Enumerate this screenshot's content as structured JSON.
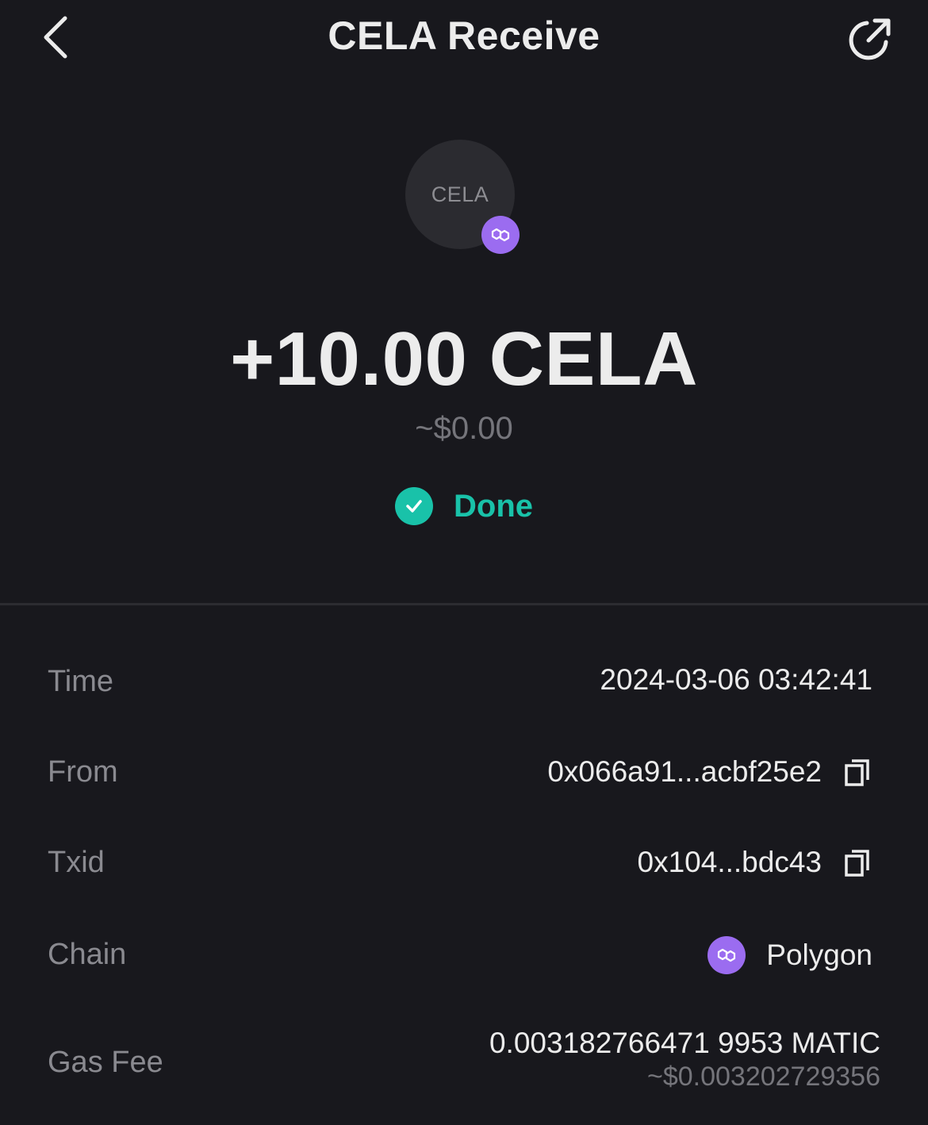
{
  "header": {
    "title": "CELA Receive",
    "back_icon": "chevron-left-icon",
    "share_icon": "external-link-icon"
  },
  "token": {
    "symbol": "CELA",
    "chain_badge_icon": "polygon-icon"
  },
  "amount": {
    "value": "+10.00 CELA",
    "fiat": "~$0.00"
  },
  "status": {
    "label": "Done",
    "icon": "check-circle-icon",
    "color": "#19c2a9"
  },
  "details": {
    "time": {
      "label": "Time",
      "value": "2024-03-06 03:42:41"
    },
    "from": {
      "label": "From",
      "value": "0x066a91...acbf25e2",
      "copy_icon": "copy-icon"
    },
    "txid": {
      "label": "Txid",
      "value": "0x104...bdc43",
      "copy_icon": "copy-icon"
    },
    "chain": {
      "label": "Chain",
      "value": "Polygon",
      "icon": "polygon-icon",
      "icon_color": "#9b6cf0"
    },
    "gas_fee": {
      "label": "Gas Fee",
      "value": "0.003182766471 9953 MATIC",
      "fiat": "~$0.003202729356"
    }
  },
  "colors": {
    "background": "#18181d",
    "accent": "#19c2a9",
    "polygon": "#9b6cf0"
  }
}
